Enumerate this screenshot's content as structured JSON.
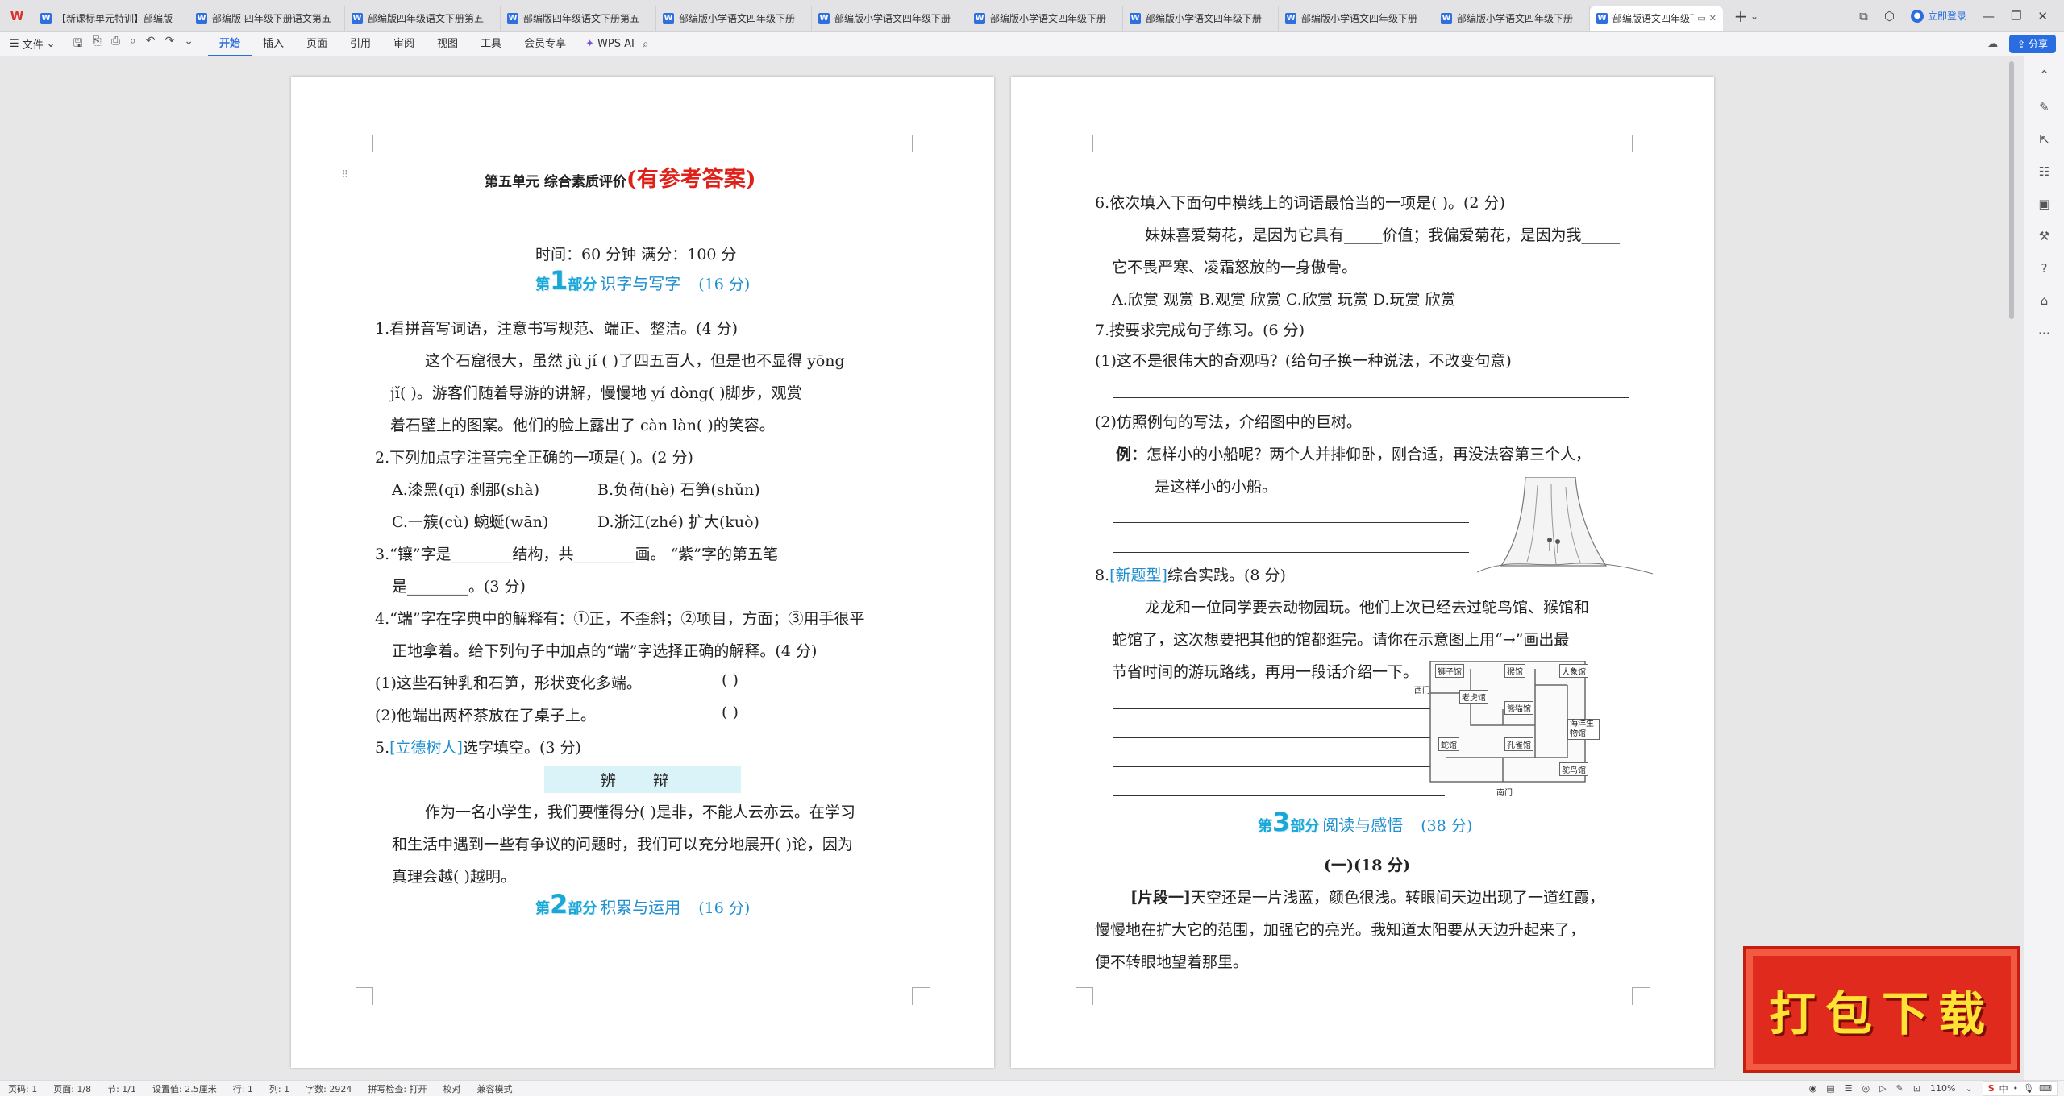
{
  "tabbar": {
    "tabs": [
      "【新课标单元特训】部编版",
      "部编版 四年级下册语文第五",
      "部编版四年级语文下册第五",
      "部编版四年级语文下册第五",
      "部编版小学语文四年级下册",
      "部编版小学语文四年级下册",
      "部编版小学语文四年级下册",
      "部编版小学语文四年级下册",
      "部编版小学语文四年级下册",
      "部编版小学语文四年级下册"
    ],
    "active_tab": "部编版语文四年级下",
    "login": "立即登录"
  },
  "ribbon": {
    "file": "文件",
    "tabs": [
      "开始",
      "插入",
      "页面",
      "引用",
      "审阅",
      "视图",
      "工具",
      "会员专享"
    ],
    "active": "开始",
    "wps_ai": "WPS AI",
    "share": "分享"
  },
  "page1": {
    "title": "第五单元 综合素质评价",
    "title_red": "(有参考答案)",
    "time_line": "时间：60 分钟   满分：100 分",
    "part1": {
      "badge_prefix": "第",
      "num": "1",
      "badge_suffix": "部分",
      "title": "识字与写字",
      "points": "(16 分)"
    },
    "q1": "1.看拼音写词语，注意书写规范、端正、整洁。(4 分)",
    "q1_l1": "这个石窟很大，虽然 jù jí (       )了四五百人，但是也不显得 yōng",
    "q1_l2": "jǐ(       )。游客们随着导游的讲解，慢慢地 yí dòng(        )脚步，观赏",
    "q1_l3": "着石壁上的图案。他们的脸上露出了 càn làn(        )的笑容。",
    "q2": "2.下列加点字注音完全正确的一项是(     )。(2 分)",
    "q2_a": "A.漆黑(qī)   刹那(shà)",
    "q2_b": "B.负荷(hè)    石笋(shǔn)",
    "q2_c": "C.一簇(cù)   蜿蜒(wān)",
    "q2_d": "D.浙江(zhé)   扩大(kuò)",
    "q3_l1": "3.“镶”字是________结构，共________画。 “紫”字的第五笔",
    "q3_l2": "是________。(3 分)",
    "q4_l1": "4.“端”字在字典中的解释有：①正，不歪斜；②项目，方面；③用手很平",
    "q4_l2": "正地拿着。给下列句子中加点的“端”字选择正确的解释。(4 分)",
    "q4_1": "(1)这些石钟乳和石笋，形状变化多端。",
    "q4_1_blank": "(      )",
    "q4_2": "(2)他端出两杯茶放在了桌子上。",
    "q4_2_blank": "(      )",
    "q5_num": "5.",
    "q5_tag": "[立德树人]",
    "q5_text": "选字填空。(3 分)",
    "q5_words": "辨 辩",
    "q5_p1": "作为一名小学生，我们要懂得分(      )是非，不能人云亦云。在学习",
    "q5_p2": "和生活中遇到一些有争议的问题时，我们可以充分地展开(      )论，因为",
    "q5_p3": "真理会越(      )越明。",
    "part2": {
      "badge_prefix": "第",
      "num": "2",
      "badge_suffix": "部分",
      "title": "积累与运用",
      "points": "(16 分)"
    }
  },
  "page2": {
    "q6": "6.依次填入下面句中横线上的词语最恰当的一项是(      )。(2 分)",
    "q6_l1": "妹妹喜爱菊花，是因为它具有_____价值；我偏爱菊花，是因为我_____",
    "q6_l2": "它不畏严寒、凌霜怒放的一身傲骨。",
    "q6_opts": "A.欣赏   观赏        B.观赏   欣赏        C.欣赏   玩赏        D.玩赏   欣赏",
    "q7": "7.按要求完成句子练习。(6 分)",
    "q7_1": "(1)这不是很伟大的奇观吗？(给句子换一种说法，不改变句意)",
    "q7_2": "(2)仿照例句的写法，介绍图中的巨树。",
    "q7_ex_label": "例：",
    "q7_ex_l1": "怎样小的小船呢？两个人并排仰卧，刚合适，再没法容第三个人，",
    "q7_ex_l2": "是这样小的小船。",
    "q8_num": "8.",
    "q8_tag": "[新题型]",
    "q8_text": "综合实践。(8 分)",
    "q8_l1": "龙龙和一位同学要去动物园玩。他们上次已经去过鸵鸟馆、猴馆和",
    "q8_l2": "蛇馆了，这次想要把其他的馆都逛完。请你在示意图上用“→”画出最",
    "q8_l3": "节省时间的游玩路线，再用一段话介绍一下。",
    "map": {
      "west_gate": "西门",
      "south_gate": "南门",
      "lion": "狮子馆",
      "monkey": "猴馆",
      "elephant": "大象馆",
      "tiger": "老虎馆",
      "panda": "熊猫馆",
      "ocean": "海洋生物馆",
      "snake": "蛇馆",
      "peacock": "孔雀馆",
      "ostrich": "鸵鸟馆"
    },
    "part3": {
      "badge_prefix": "第",
      "num": "3",
      "badge_suffix": "部分",
      "title": "阅读与感悟",
      "points": "(38 分)"
    },
    "reading_title": "(一)(18 分)",
    "frag_label": "[片段一]",
    "frag_l1": "天空还是一片浅蓝，颜色很浅。转眼间天边出现了一道红霞，",
    "frag_l2": "慢慢地在扩大它的范围，加强它的亮光。我知道太阳要从天边升起来了，",
    "frag_l3": "便不转眼地望着那里。"
  },
  "promo": "打包下载",
  "status": {
    "page_code": "页码: 1",
    "page": "页面: 1/8",
    "section": "节: 1/1",
    "setting": "设置值: 2.5厘米",
    "row": "行: 1",
    "col": "列: 1",
    "words": "字数: 2924",
    "spell": "拼写检查: 打开",
    "proof": "校对",
    "compat": "兼容模式",
    "zoom": "110%",
    "ime_lang": "中"
  },
  "colors": {
    "accent": "#2a6de0",
    "red": "#e0211a",
    "section_blue": "#1f8fd0"
  }
}
